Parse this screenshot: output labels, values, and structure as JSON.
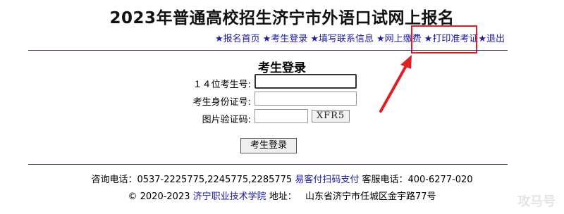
{
  "header": {
    "title": "2023年普通高校招生济宁市外语口试网上报名"
  },
  "nav": {
    "star": "★",
    "items": [
      "报名首页",
      "考生登录",
      "填写联系信息",
      "网上缴费",
      "打印准考证",
      "退出"
    ]
  },
  "login": {
    "heading": "考生登录",
    "fields": [
      {
        "label": "１４位考生号:",
        "value": ""
      },
      {
        "label": "考生身份证号:",
        "value": ""
      },
      {
        "label": "图片验证码:",
        "value": ""
      }
    ],
    "captcha_text": "XFR5",
    "submit_label": "考生登录"
  },
  "footer": {
    "contact_prefix": "咨询电话：0537-2225775,2245775,2285775",
    "pay_link": "易客付扫码支付",
    "service_phone": "客服电话：400-6277-020",
    "copyright": "© 2020-2023",
    "school_link": "济宁职业技术学院",
    "address_label": "地址：",
    "address": "山东省济宁市任城区金宇路77号"
  },
  "watermark": "攻马号",
  "colors": {
    "link": "#1a1aa6",
    "rule": "#333399",
    "highlight": "#e02020"
  }
}
